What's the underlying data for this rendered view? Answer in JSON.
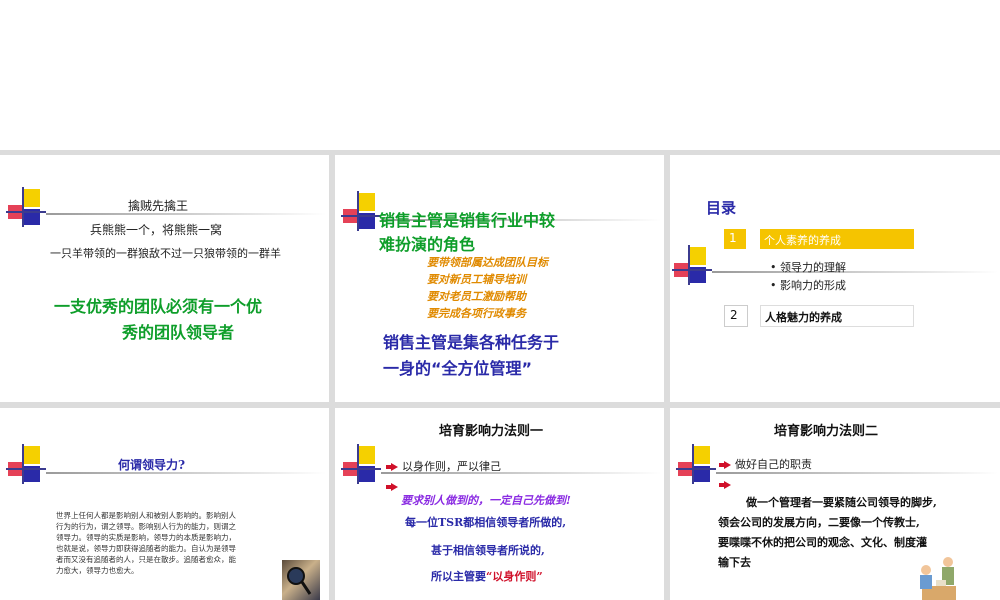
{
  "slide1": {
    "title": "擒贼先擒王",
    "line1": "兵熊熊一个，将熊熊一窝",
    "line2": "一只羊带领的一群狼敌不过一只狼带领的一群羊",
    "slogan_1": "一支优秀的团队必须有一个优",
    "slogan_2": "秀的团队领导者"
  },
  "slide2": {
    "heading_1": "销售主管是销售行业中较",
    "heading_2": "难扮演的角色",
    "items": [
      "要带领部属达成团队目标",
      "要对新员工辅导培训",
      "要对老员工激励帮助",
      "要完成各项行政事务"
    ],
    "footer_1": "销售主管是集各种任务于",
    "footer_2": "一身的“全方位管理”"
  },
  "slide3": {
    "title": "目录",
    "section1_num": "1",
    "section1_label": "个人素养的养成",
    "sub_items": [
      "领导力的理解",
      "影响力的形成"
    ],
    "section2_num": "2",
    "section2_label": "人格魅力的养成"
  },
  "slide4": {
    "title": "何谓领导力?",
    "body_lines": [
      "世界上任何人都是影响别人和被别人影响的。影响别人",
      "行为的行为，谓之领导。影响别人行为的能力，则谓之",
      "领导力。领导的实质是影响，领导力的本质是影响力，",
      "也就是说，领导力即获得追随者的能力。自认为是领导",
      "者而又没有追随者的人，只是在散步。追随者愈众，能",
      "力愈大，领导力也愈大。"
    ]
  },
  "slide5": {
    "title": "培育影响力法则一",
    "bullet1": "以身作则，严以律己",
    "quote": "要求别人做到的，一定自己先做到!",
    "line1": "每一位TSR都相信领导者所做的,",
    "line2": "甚于相信领导者所说的,",
    "line3_prefix": "所以主管要",
    "line3_quote": "“以身作则”"
  },
  "slide6": {
    "title": "培育影响力法则二",
    "bullet1": "做好自己的职责",
    "para_lines": [
      "做一个管理者一要紧随公司领导的脚步,",
      "领会公司的发展方向，二要像一个传教士,",
      "要喋喋不休的把公司的观念、文化、制度灌",
      "输下去"
    ]
  },
  "colors": {
    "green": "#0e9e2a",
    "blue": "#2a2aa8",
    "orange": "#e08a00",
    "purple": "#8a2be2",
    "yellow": "#f5c400",
    "red": "#d0102a"
  }
}
